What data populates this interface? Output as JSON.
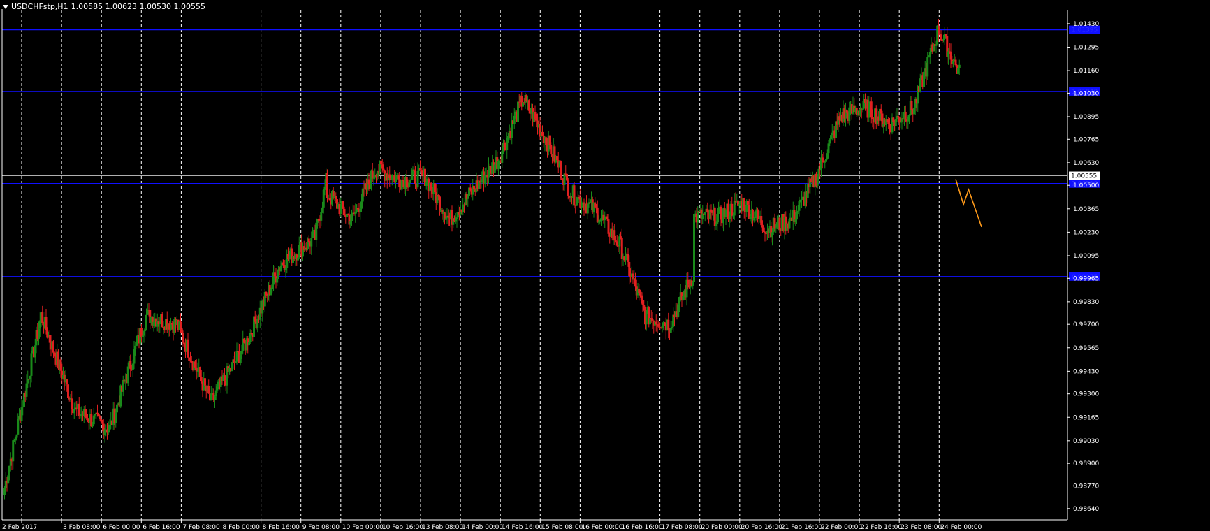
{
  "header": {
    "symbol": "USDCHFstp,H1",
    "ohlc": "1.00585 1.00623 1.00530 1.00555"
  },
  "colors": {
    "background": "#000000",
    "axis": "#ffffff",
    "grid": "#ffffff",
    "bull": "#1a8a1a",
    "bear": "#e02020",
    "hline": "#1010ff",
    "projection": "#ff9a1a",
    "price_line": "#b0b0b0"
  },
  "chart_data": {
    "type": "candlestick",
    "title": "USDCHFstp,H1",
    "ylim": [
      0.98575,
      1.0151
    ],
    "grid": "vertical dashed",
    "y_ticks": [
      "1.01430",
      "1.01295",
      "1.01160",
      "1.01030",
      "1.00895",
      "1.00765",
      "1.00630",
      "1.00500",
      "1.00365",
      "1.00230",
      "1.00095",
      "0.99965",
      "0.99830",
      "0.99700",
      "0.99565",
      "0.99430",
      "0.99300",
      "0.99165",
      "0.99030",
      "0.98900",
      "0.98770",
      "0.98640"
    ],
    "x_ticks": [
      "2 Feb 2017",
      "3 Feb 08:00",
      "6 Feb 00:00",
      "6 Feb 16:00",
      "7 Feb 08:00",
      "8 Feb 00:00",
      "8 Feb 16:00",
      "9 Feb 08:00",
      "10 Feb 00:00",
      "10 Feb 16:00",
      "13 Feb 08:00",
      "14 Feb 00:00",
      "14 Feb 16:00",
      "15 Feb 08:00",
      "16 Feb 00:00",
      "16 Feb 16:00",
      "17 Feb 08:00",
      "20 Feb 00:00",
      "20 Feb 16:00",
      "21 Feb 16:00",
      "22 Feb 00:00",
      "22 Feb 16:00",
      "23 Feb 08:00",
      "24 Feb 00:00"
    ],
    "current_price": "1.00555",
    "horizontal_levels": [
      1.01395,
      1.0104,
      1.0051,
      0.99975
    ],
    "hidden_level_labels": [
      "1.01395",
      "1.01040",
      "1.00510",
      "0.99975"
    ],
    "projection": [
      [
        0,
        1.00535
      ],
      [
        3,
        1.0039
      ],
      [
        5,
        1.00475
      ],
      [
        10,
        1.0026
      ]
    ],
    "series": [
      {
        "x": [
          0,
          30,
          58,
          86,
          116,
          141,
          169,
          198,
          226,
          254,
          264
        ],
        "close": [
          0.9876,
          0.9975,
          0.992,
          0.991,
          0.9975,
          0.997,
          0.9925,
          0.996,
          1.0005,
          1.002,
          1.00555
        ]
      },
      {
        "x": [
          300,
          320,
          340,
          360,
          380,
          400,
          420,
          440,
          460,
          480,
          500,
          520,
          540,
          560,
          580,
          600
        ],
        "close": [
          1.0045,
          1.003,
          1.006,
          1.0053,
          1.0055,
          1.003,
          1.0048,
          1.0065,
          1.01,
          1.0075,
          1.0045,
          1.0035,
          1.0015,
          0.9975,
          0.997,
          1.0
        ]
      },
      {
        "x": [
          620,
          640,
          660,
          680,
          700,
          720,
          740,
          760,
          780,
          800,
          820,
          840,
          860,
          880
        ],
        "close": [
          1.0032,
          1.0032,
          1.004,
          1.0025,
          1.003,
          1.0055,
          1.009,
          1.0095,
          1.0085,
          1.0095,
          1.014,
          1.011,
          1.0105,
          1.00555
        ]
      }
    ]
  }
}
